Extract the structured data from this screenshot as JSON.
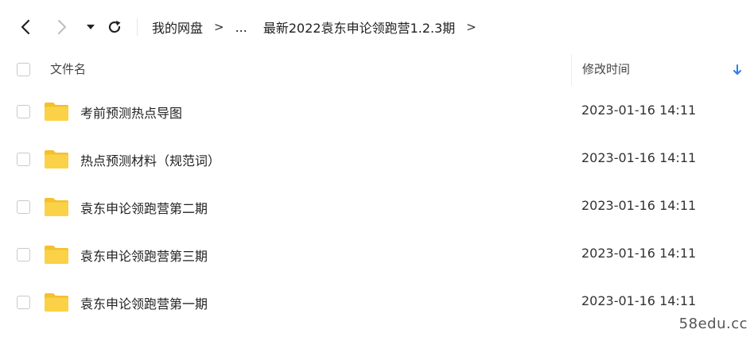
{
  "nav": {
    "back_icon": "chevron-left-icon",
    "forward_icon": "chevron-right-icon",
    "menu_icon": "caret-down-icon",
    "refresh_icon": "refresh-icon"
  },
  "breadcrumb": {
    "root": "我的网盘",
    "separator": ">",
    "ellipsis": "...",
    "current": "最新2022袁东申论领跑营1.2.3期"
  },
  "table_header": {
    "name_label": "文件名",
    "time_label": "修改时间",
    "sort_icon": "arrow-down-icon"
  },
  "rows": [
    {
      "name": "考前预测热点导图",
      "time": "2023-01-16 14:11"
    },
    {
      "name": "热点预测材料（规范词）",
      "time": "2023-01-16 14:11"
    },
    {
      "name": "袁东申论领跑营第二期",
      "time": "2023-01-16 14:11"
    },
    {
      "name": "袁东申论领跑营第三期",
      "time": "2023-01-16 14:11"
    },
    {
      "name": "袁东申论领跑营第一期",
      "time": "2023-01-16 14:11"
    }
  ],
  "watermark": "58edu.cc",
  "colors": {
    "folder": "#fbd247",
    "folder_dark": "#f5c02c",
    "accent_sort": "#2b7de9",
    "checkbox_border": "#c9c9c9"
  }
}
